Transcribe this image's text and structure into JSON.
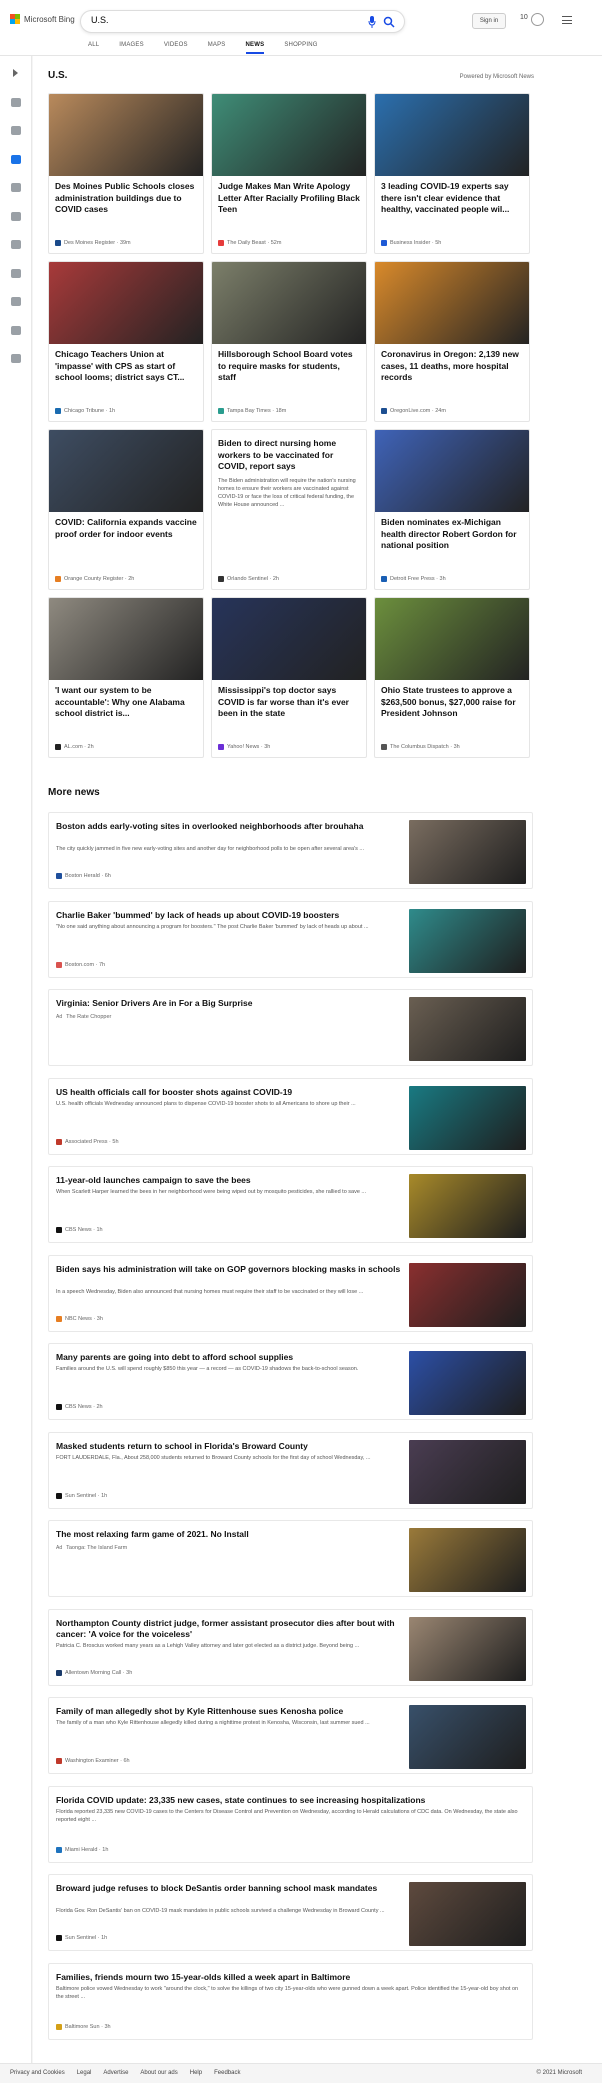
{
  "header": {
    "logo_text": "Microsoft Bing",
    "search_value": "U.S.",
    "signin_label": "Sign in",
    "reward_points": "10"
  },
  "tabs": [
    "ALL",
    "IMAGES",
    "VIDEOS",
    "MAPS",
    "NEWS",
    "SHOPPING"
  ],
  "active_tab": "NEWS",
  "section": {
    "title": "U.S.",
    "powered_by": "Powered by Microsoft News"
  },
  "top_cards": [
    {
      "title": "Des Moines Public Schools closes administration buildings due to COVID cases",
      "source": "Des Moines Register",
      "time": "39m",
      "color": "#b98a5c",
      "icon": "#1a4a8a"
    },
    {
      "title": "Judge Makes Man Write Apology Letter After Racially Profiling Black Teen",
      "source": "The Daily Beast",
      "time": "52m",
      "color": "#3f8d77",
      "icon": "#e63c3c"
    },
    {
      "title": "3 leading COVID-19 experts say there isn't clear evidence that healthy, vaccinated people wil...",
      "source": "Business Insider",
      "time": "5h",
      "color": "#2b6fae",
      "icon": "#1f5ad6"
    },
    {
      "title": "Chicago Teachers Union at 'impasse' with CPS as start of school looms; district says CT...",
      "source": "Chicago Tribune",
      "time": "1h",
      "color": "#a83a3a",
      "icon": "#1a6bb0"
    },
    {
      "title": "Hillsborough School Board votes to require masks for students, staff",
      "source": "Tampa Bay Times",
      "time": "18m",
      "color": "#7c7f6a",
      "icon": "#2a9d8f"
    },
    {
      "title": "Coronavirus in Oregon: 2,139 new cases, 11 deaths, more hospital records",
      "source": "OregonLive.com",
      "time": "24m",
      "color": "#d98a2b",
      "icon": "#1d4f91"
    },
    {
      "title": "COVID: California expands vaccine proof order for indoor events",
      "source": "Orange County Register",
      "time": "2h",
      "color": "#3e4d62",
      "icon": "#e67e22"
    },
    {
      "title": "Biden to direct nursing home workers to be vaccinated for COVID, report says",
      "snippet": "The Biden administration will require the nation's nursing homes to ensure their workers are vaccinated against COVID-19 or face the loss of critical federal funding, the White House announced ...",
      "source": "Orlando Sentinel",
      "time": "2h",
      "icon": "#333"
    },
    {
      "title": "Biden nominates ex-Michigan health director Robert Gordon for national position",
      "source": "Detroit Free Press",
      "time": "3h",
      "color": "#3f63b8",
      "icon": "#1a5fb4"
    },
    {
      "title": "'I want our system to be accountable': Why one Alabama school district is...",
      "source": "AL.com",
      "time": "2h",
      "color": "#8f8a80",
      "icon": "#222"
    },
    {
      "title": "Mississippi's top doctor says COVID is far worse than it's ever been in the state",
      "source": "Yahoo! News",
      "time": "3h",
      "color": "#27345a",
      "icon": "#6b2fd6"
    },
    {
      "title": "Ohio State trustees to approve a $263,500 bonus, $27,000 raise for President Johnson",
      "source": "The Columbus Dispatch",
      "time": "3h",
      "color": "#6c8f3d",
      "icon": "#555"
    }
  ],
  "more_news_title": "More news",
  "more_news": [
    {
      "title": "Boston adds early-voting sites in overlooked neighborhoods after brouhaha",
      "snippet": "The city quickly jammed in five new early-voting sites and another day for neighborhood polls to be open after several area's ...",
      "source": "Boston Herald",
      "time": "6h",
      "color": "#7a6d60",
      "icon": "#1f4f9c"
    },
    {
      "title": "Charlie Baker 'bummed' by lack of heads up about COVID-19 boosters",
      "snippet": "\"No one said anything about announcing a program for boosters.\" The post Charlie Baker 'bummed' by lack of heads up about ...",
      "source": "Boston.com",
      "time": "7h",
      "color": "#2f8b8b",
      "icon": "#d9534f"
    },
    {
      "title": "Virginia: Senior Drivers Are in For a Big Surprise",
      "ad": "Ad",
      "source": "The Rate Chopper",
      "time": "",
      "color": "#6a5f52",
      "icon": ""
    },
    {
      "title": "US health officials call for booster shots against COVID-19",
      "snippet": "U.S. health officials Wednesday announced plans to dispense COVID-19 booster shots to all Americans to shore up their ...",
      "source": "Associated Press",
      "time": "5h",
      "color": "#197a82",
      "icon": "#c0392b"
    },
    {
      "title": "11-year-old launches campaign to save the bees",
      "snippet": "When Scarlett Harper learned the bees in her neighborhood were being wiped out by mosquito pesticides, she rallied to save ...",
      "source": "CBS News",
      "time": "1h",
      "color": "#a88a2a",
      "icon": "#111"
    },
    {
      "title": "Biden says his administration will take on GOP governors blocking masks in schools",
      "snippet": "In a speech Wednesday, Biden also announced that nursing homes must require their staff to be vaccinated or they will lose ...",
      "source": "NBC News",
      "time": "3h",
      "color": "#8a2f2f",
      "icon": "#e67e22"
    },
    {
      "title": "Many parents are going into debt to afford school supplies",
      "snippet": "Families around the U.S. will spend roughly $850 this year — a record — as COVID-19 shadows the back-to-school season.",
      "source": "CBS News",
      "time": "2h",
      "color": "#2c4fa6",
      "icon": "#111"
    },
    {
      "title": "Masked students return to school in Florida's Broward County",
      "snippet": "FORT LAUDERDALE, Fla., About 258,000 students returned to Broward County schools for the first day of school Wednesday, ...",
      "source": "Sun Sentinel",
      "time": "1h",
      "color": "#4a3d52",
      "icon": "#111"
    },
    {
      "title": "The most relaxing farm game of 2021. No Install",
      "ad": "Ad",
      "source": "Taonga: The Island Farm",
      "time": "",
      "color": "#9a7a3a",
      "icon": ""
    },
    {
      "title": "Northampton County district judge, former assistant prosecutor dies after bout with cancer: 'A voice for the voiceless'",
      "snippet": "Patricia C. Broscius worked many years as a Lehigh Valley attorney and later got elected as a district judge. Beyond being ...",
      "source": "Allentown Morning Call",
      "time": "3h",
      "color": "#9a8672",
      "icon": "#1a3a6a"
    },
    {
      "title": "Family of man allegedly shot by Kyle Rittenhouse sues Kenosha police",
      "snippet": "The family of a man who Kyle Rittenhouse allegedly killed during a nighttime protest in Kenosha, Wisconsin, last summer sued ...",
      "source": "Washington Examiner",
      "time": "6h",
      "color": "#38506a",
      "icon": "#c0392b"
    },
    {
      "title": "Florida COVID update: 23,335 new cases, state continues to see increasing hospitalizations",
      "snippet": "Florida reported 23,335 new COVID-19 cases to the Centers for Disease Control and Prevention on Wednesday, according to Herald calculations of CDC data. On Wednesday, the state also reported eight ...",
      "source": "Miami Herald",
      "time": "1h",
      "color": "",
      "icon": "#1e73be"
    },
    {
      "title": "Broward judge refuses to block DeSantis order banning school mask mandates",
      "snippet": "Florida Gov. Ron DeSantis' ban on COVID-19 mask mandates in public schools survived a challenge Wednesday in Broward County ...",
      "source": "Sun Sentinel",
      "time": "1h",
      "color": "#5e4a3e",
      "icon": "#111"
    },
    {
      "title": "Families, friends mourn two 15-year-olds killed a week apart in Baltimore",
      "snippet": "Baltimore police vowed Wednesday to work \"around the clock,\" to solve the killings of two city 15-year-olds who were gunned down a week apart. Police identified the 15-year-old boy shot on the street ...",
      "source": "Baltimore Sun",
      "time": "3h",
      "color": "",
      "icon": "#d4a017"
    }
  ],
  "footer": {
    "links": [
      "Privacy and Cookies",
      "Legal",
      "Advertise",
      "About our ads",
      "Help",
      "Feedback"
    ],
    "copyright": "© 2021 Microsoft"
  }
}
